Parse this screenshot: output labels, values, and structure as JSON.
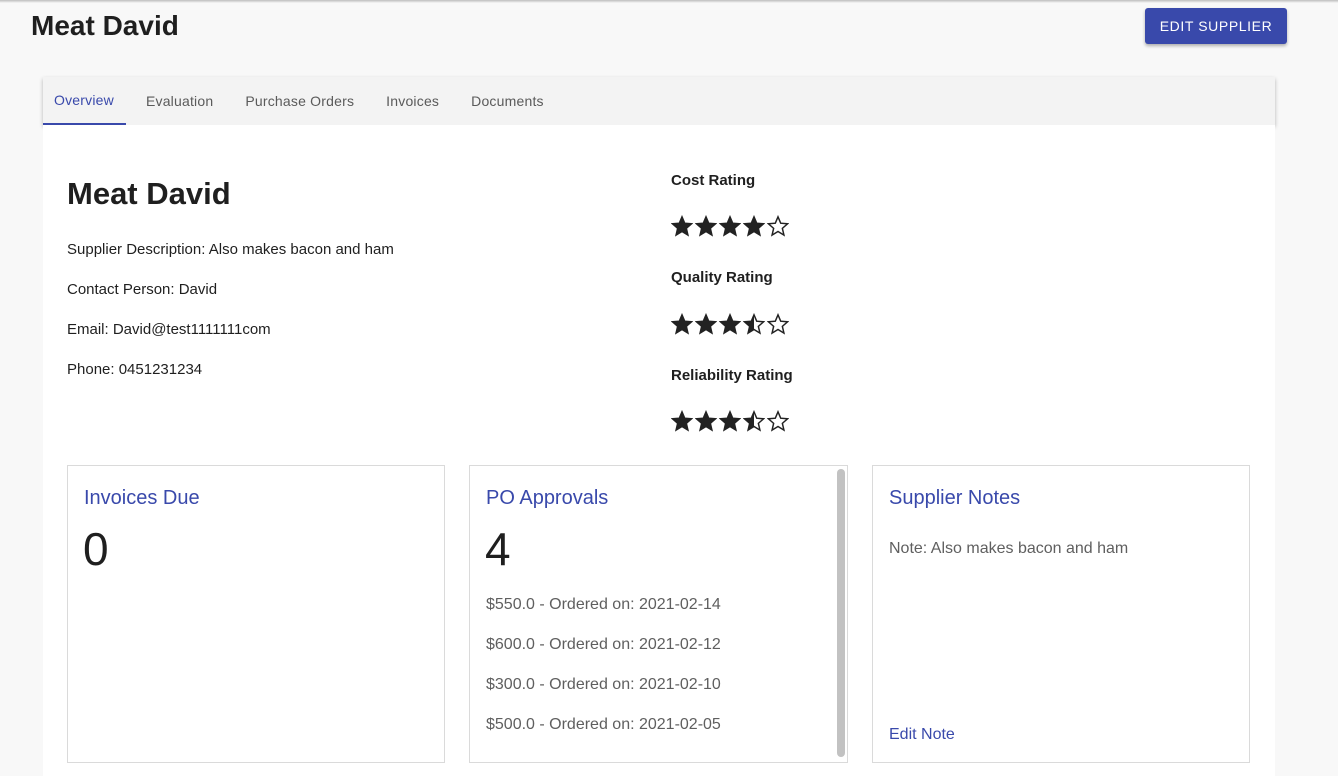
{
  "page": {
    "title": "Meat David",
    "edit_button": "EDIT SUPPLIER"
  },
  "tabs": [
    {
      "label": "Overview",
      "active": true
    },
    {
      "label": "Evaluation",
      "active": false
    },
    {
      "label": "Purchase Orders",
      "active": false
    },
    {
      "label": "Invoices",
      "active": false
    },
    {
      "label": "Documents",
      "active": false
    }
  ],
  "supplier": {
    "name": "Meat David",
    "description": "Supplier Description: Also makes bacon and ham",
    "contact": "Contact Person: David",
    "email": "Email: David@test1111111com",
    "phone": "Phone: 0451231234"
  },
  "ratings": [
    {
      "label": "Cost Rating",
      "value": 4,
      "max": 5
    },
    {
      "label": "Quality Rating",
      "value": 3.5,
      "max": 5
    },
    {
      "label": "Reliability Rating",
      "value": 3.5,
      "max": 5
    }
  ],
  "cards": {
    "invoices_due": {
      "title": "Invoices Due",
      "count": "0"
    },
    "po_approvals": {
      "title": "PO Approvals",
      "count": "4",
      "items": [
        "$550.0 - Ordered on: 2021-02-14",
        "$600.0 - Ordered on: 2021-02-12",
        "$300.0 - Ordered on: 2021-02-10",
        "$500.0 - Ordered on: 2021-02-05"
      ]
    },
    "supplier_notes": {
      "title": "Supplier Notes",
      "note": "Note: Also makes bacon and ham",
      "edit_link": "Edit Note"
    }
  },
  "colors": {
    "accent": "#3949ab",
    "star": "#222222"
  }
}
